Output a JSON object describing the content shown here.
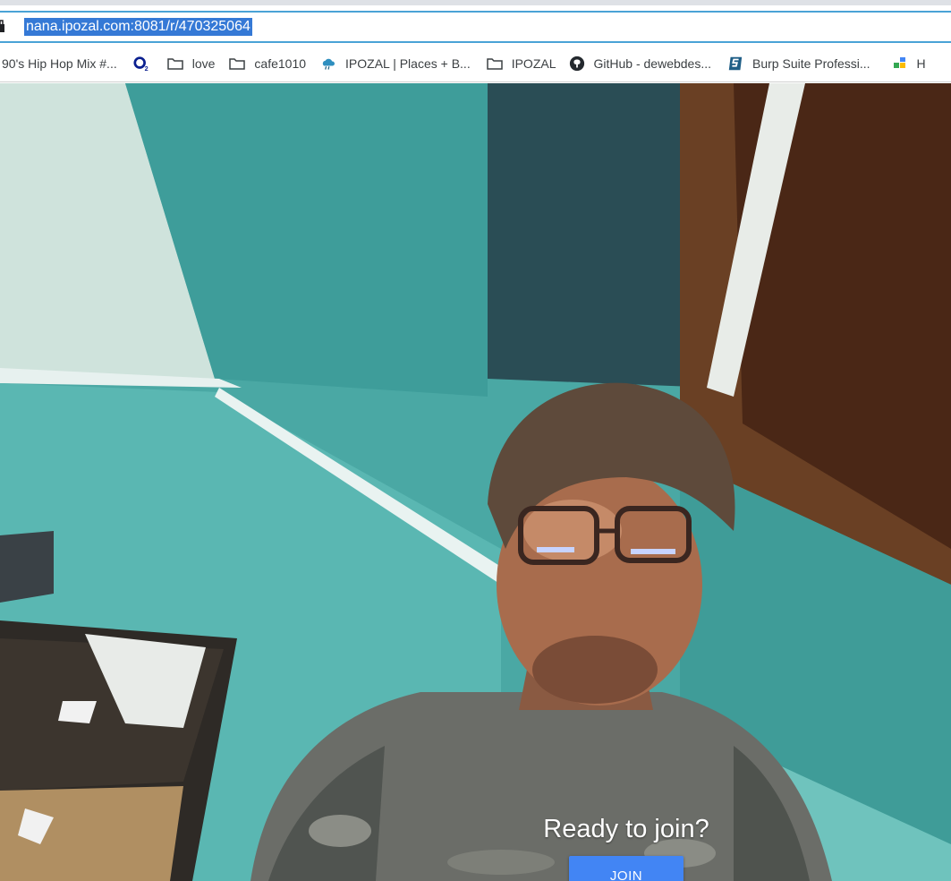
{
  "browser": {
    "url": "nana.ipozal.com:8081/r/470325064",
    "bookmarks": [
      {
        "label": "90's Hip Hop Mix #...",
        "icon": "none"
      },
      {
        "label": "",
        "icon": "o2-logo-icon"
      },
      {
        "label": "love",
        "icon": "folder-icon"
      },
      {
        "label": "cafe1010",
        "icon": "folder-icon"
      },
      {
        "label": "IPOZAL | Places + B...",
        "icon": "ipozal-cloud-icon"
      },
      {
        "label": "IPOZAL",
        "icon": "folder-icon"
      },
      {
        "label": "GitHub - dewebdes...",
        "icon": "github-icon"
      },
      {
        "label": "Burp Suite Professi...",
        "icon": "burp-suite-icon"
      },
      {
        "label": "H",
        "icon": "google-apps-icon"
      }
    ]
  },
  "video": {
    "description_icon": "webcam-preview",
    "join_prompt": "Ready to join?",
    "join_button_label": "JOIN"
  },
  "colors": {
    "join_button": "#4285f4",
    "url_highlight": "#3579d6",
    "wall": "#4aa8a4"
  }
}
